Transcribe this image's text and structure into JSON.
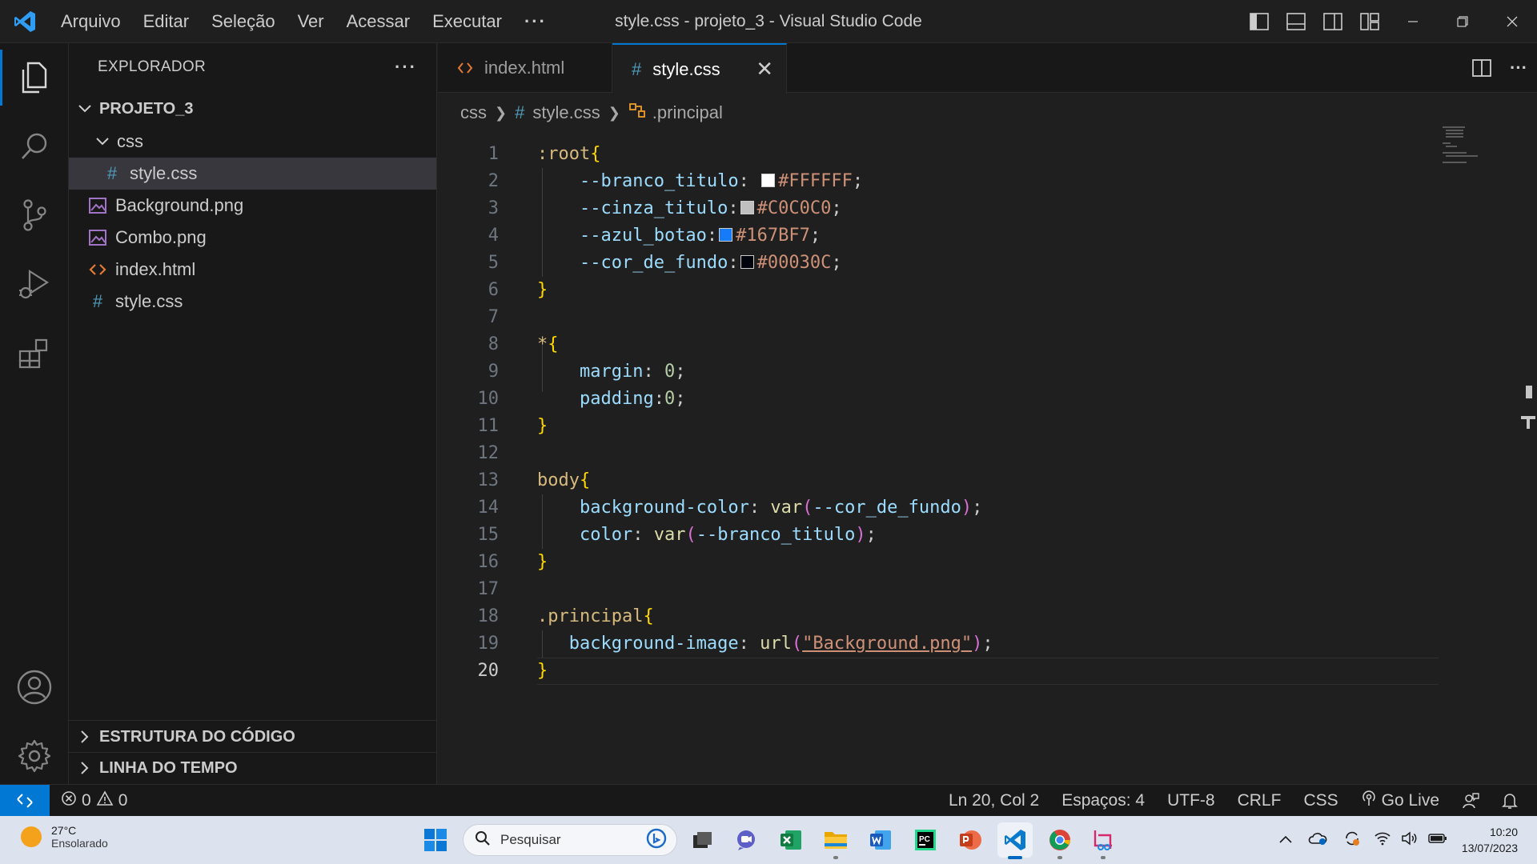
{
  "window": {
    "title": "style.css - projeto_3 - Visual Studio Code",
    "menu": [
      "Arquivo",
      "Editar",
      "Seleção",
      "Ver",
      "Acessar",
      "Executar",
      "···"
    ]
  },
  "activity_bar": {
    "items": [
      "explorer-icon",
      "search-icon",
      "source-control-icon",
      "run-debug-icon",
      "extensions-icon",
      "account-icon",
      "settings-gear-icon"
    ]
  },
  "sidebar": {
    "title": "EXPLORADOR",
    "more": "···",
    "project": "PROJETO_3",
    "tree": [
      {
        "label": "css",
        "type": "folder"
      },
      {
        "label": "style.css",
        "type": "css"
      },
      {
        "label": "Background.png",
        "type": "image"
      },
      {
        "label": "Combo.png",
        "type": "image"
      },
      {
        "label": "index.html",
        "type": "html"
      },
      {
        "label": "style.css",
        "type": "css"
      }
    ],
    "panels": [
      "ESTRUTURA DO CÓDIGO",
      "LINHA DO TEMPO"
    ]
  },
  "tabs": [
    {
      "label": "index.html",
      "icon": "<>"
    },
    {
      "label": "style.css",
      "icon": "#",
      "close": "✕"
    }
  ],
  "breadcrumb": [
    "css",
    "style.css",
    ".principal"
  ],
  "code_lines": [
    {
      "n": "1",
      "tokens": [
        [
          ":root",
          "t-sel"
        ],
        [
          "{",
          "t-brace"
        ]
      ]
    },
    {
      "n": "2",
      "tokens": [
        [
          "    --branco_titulo",
          "t-var"
        ],
        [
          ": ",
          "t-punc"
        ],
        [
          "#FFFFFF",
          "t-val",
          "#FFFFFF"
        ],
        [
          ";",
          "t-punc"
        ]
      ]
    },
    {
      "n": "3",
      "tokens": [
        [
          "    --cinza_titulo",
          "t-var"
        ],
        [
          ":",
          "t-punc"
        ],
        [
          "#C0C0C0",
          "t-val",
          "#C0C0C0"
        ],
        [
          ";",
          "t-punc"
        ]
      ]
    },
    {
      "n": "4",
      "tokens": [
        [
          "    --azul_botao",
          "t-var"
        ],
        [
          ":",
          "t-punc"
        ],
        [
          "#167BF7",
          "t-val",
          "#167BF7"
        ],
        [
          ";",
          "t-punc"
        ]
      ]
    },
    {
      "n": "5",
      "tokens": [
        [
          "    --cor_de_fundo",
          "t-var"
        ],
        [
          ":",
          "t-punc"
        ],
        [
          "#00030C",
          "t-val",
          "#00030C"
        ],
        [
          ";",
          "t-punc"
        ]
      ]
    },
    {
      "n": "6",
      "tokens": [
        [
          "}",
          "t-brace"
        ]
      ]
    },
    {
      "n": "7",
      "tokens": []
    },
    {
      "n": "8",
      "tokens": [
        [
          "*",
          "t-sel"
        ],
        [
          "{",
          "t-brace"
        ]
      ]
    },
    {
      "n": "9",
      "tokens": [
        [
          "    margin",
          "t-prop"
        ],
        [
          ": ",
          "t-punc"
        ],
        [
          "0",
          "t-num"
        ],
        [
          ";",
          "t-punc"
        ]
      ]
    },
    {
      "n": "10",
      "tokens": [
        [
          "    padding",
          "t-prop"
        ],
        [
          ":",
          "t-punc"
        ],
        [
          "0",
          "t-num"
        ],
        [
          ";",
          "t-punc"
        ]
      ]
    },
    {
      "n": "11",
      "tokens": [
        [
          "}",
          "t-brace"
        ]
      ]
    },
    {
      "n": "12",
      "tokens": []
    },
    {
      "n": "13",
      "tokens": [
        [
          "body",
          "t-sel"
        ],
        [
          "{",
          "t-brace"
        ]
      ]
    },
    {
      "n": "14",
      "tokens": [
        [
          "    background-color",
          "t-prop"
        ],
        [
          ": ",
          "t-punc"
        ],
        [
          "var",
          "t-fn"
        ],
        [
          "(",
          "t-paren"
        ],
        [
          "--cor_de_fundo",
          "t-var"
        ],
        [
          ")",
          "t-paren"
        ],
        [
          ";",
          "t-punc"
        ]
      ]
    },
    {
      "n": "15",
      "tokens": [
        [
          "    color",
          "t-prop"
        ],
        [
          ": ",
          "t-punc"
        ],
        [
          "var",
          "t-fn"
        ],
        [
          "(",
          "t-paren"
        ],
        [
          "--branco_titulo",
          "t-var"
        ],
        [
          ")",
          "t-paren"
        ],
        [
          ";",
          "t-punc"
        ]
      ]
    },
    {
      "n": "16",
      "tokens": [
        [
          "}",
          "t-brace"
        ]
      ]
    },
    {
      "n": "17",
      "tokens": []
    },
    {
      "n": "18",
      "tokens": [
        [
          ".principal",
          "t-sel"
        ],
        [
          "{",
          "t-brace"
        ]
      ]
    },
    {
      "n": "19",
      "tokens": [
        [
          "   background-image",
          "t-prop"
        ],
        [
          ": ",
          "t-punc"
        ],
        [
          "url",
          "t-fn"
        ],
        [
          "(",
          "t-paren"
        ],
        [
          "\"Background.png\"",
          "t-val"
        ],
        [
          ")",
          "t-paren"
        ],
        [
          ";",
          "t-punc"
        ]
      ]
    },
    {
      "n": "20",
      "tokens": [
        [
          "}",
          "t-brace"
        ]
      ]
    }
  ],
  "status": {
    "errors": "0",
    "warnings": "0",
    "position": "Ln 20, Col 2",
    "spaces": "Espaços: 4",
    "encoding": "UTF-8",
    "eol": "CRLF",
    "language": "CSS",
    "golive": "Go Live"
  },
  "taskbar": {
    "weather_temp": "27°C",
    "weather_desc": "Ensolarado",
    "search_placeholder": "Pesquisar",
    "time": "10:20",
    "date": "13/07/2023"
  },
  "colors": {
    "accent": "#0078d4",
    "editor_bg": "#1f1f1f",
    "sidebar_bg": "#181818"
  }
}
